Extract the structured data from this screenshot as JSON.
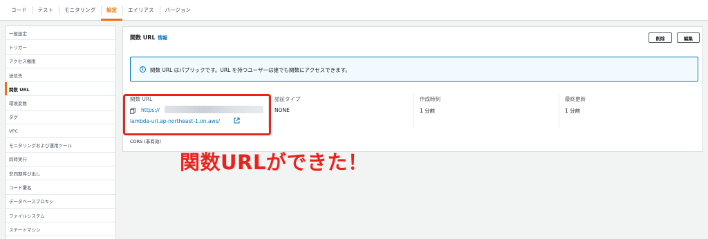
{
  "tabs": [
    {
      "label": "コード"
    },
    {
      "label": "テスト"
    },
    {
      "label": "モニタリング"
    },
    {
      "label": "設定"
    },
    {
      "label": "エイリアス"
    },
    {
      "label": "バージョン"
    }
  ],
  "sidebar": {
    "items": [
      {
        "label": "一般設定"
      },
      {
        "label": "トリガー"
      },
      {
        "label": "アクセス権限"
      },
      {
        "label": "送信先"
      },
      {
        "label": "関数 URL"
      },
      {
        "label": "環境変数"
      },
      {
        "label": "タグ"
      },
      {
        "label": "VPC"
      },
      {
        "label": "モニタリングおよび運用ツール"
      },
      {
        "label": "同時実行"
      },
      {
        "label": "非同期呼び出し"
      },
      {
        "label": "コード署名"
      },
      {
        "label": "データベースプロキシ"
      },
      {
        "label": "ファイルシステム"
      },
      {
        "label": "ステートマシン"
      }
    ]
  },
  "panel": {
    "title": "関数 URL",
    "info": "情報",
    "delete_label": "削除",
    "edit_label": "編集",
    "alert_text": "関数 URL はパブリックです。URL を持つユーザーは誰でも関数にアクセスできます。",
    "details": {
      "url_label": "関数 URL",
      "url_prefix": "https://",
      "url_suffix": "lambda-url.ap-northeast-1.on.aws/",
      "auth_label": "認証タイプ",
      "auth_value": "NONE",
      "created_label": "作成時刻",
      "created_value": "1 分前",
      "modified_label": "最終更新",
      "modified_value": "1 分前"
    },
    "cors": "CORS (非有効)"
  },
  "annotation": "関数URLができた！",
  "colors": {
    "accent": "#ec7211",
    "link": "#0073bb",
    "annotation": "#e8231c"
  }
}
